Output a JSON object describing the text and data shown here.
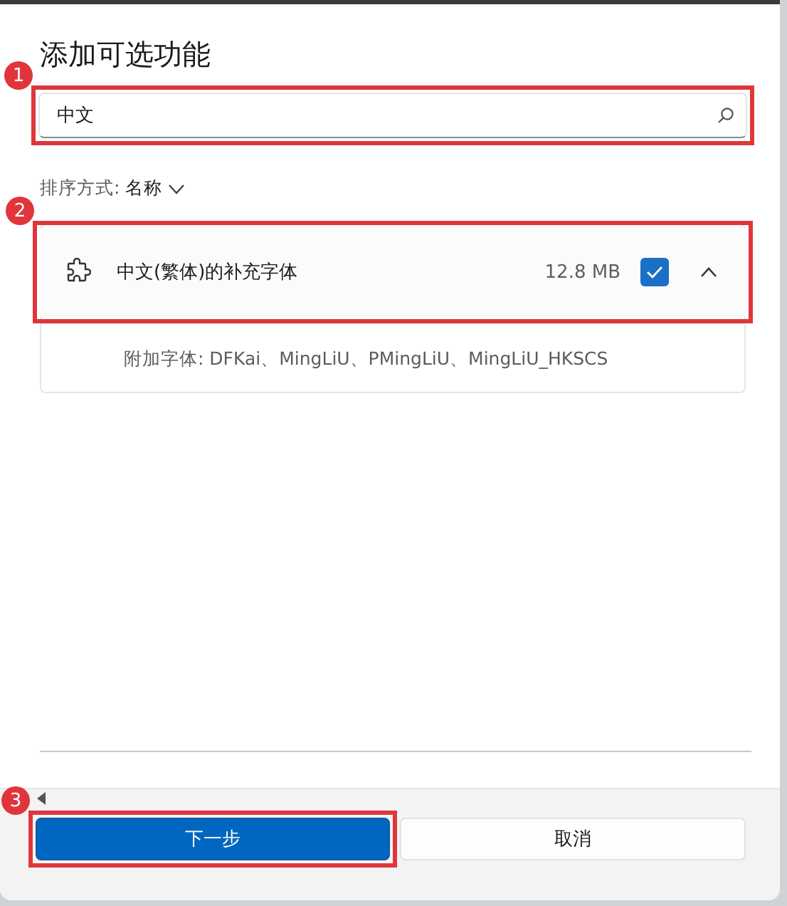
{
  "dialog": {
    "title": "添加可选功能",
    "search": {
      "value": "中文",
      "annotation": "1"
    },
    "sort": {
      "label": "排序方式:",
      "value": "名称"
    },
    "features": [
      {
        "name": "中文(繁体)的补充字体",
        "size": "12.8 MB",
        "checked": true,
        "expanded": true,
        "details": "附加字体: DFKai、MingLiU、PMingLiU、MingLiU_HKSCS",
        "annotation": "2"
      }
    ],
    "buttons": [
      {
        "label": "下一步",
        "kind": "primary",
        "annotation": "3"
      },
      {
        "label": "取消",
        "kind": "secondary"
      }
    ]
  }
}
